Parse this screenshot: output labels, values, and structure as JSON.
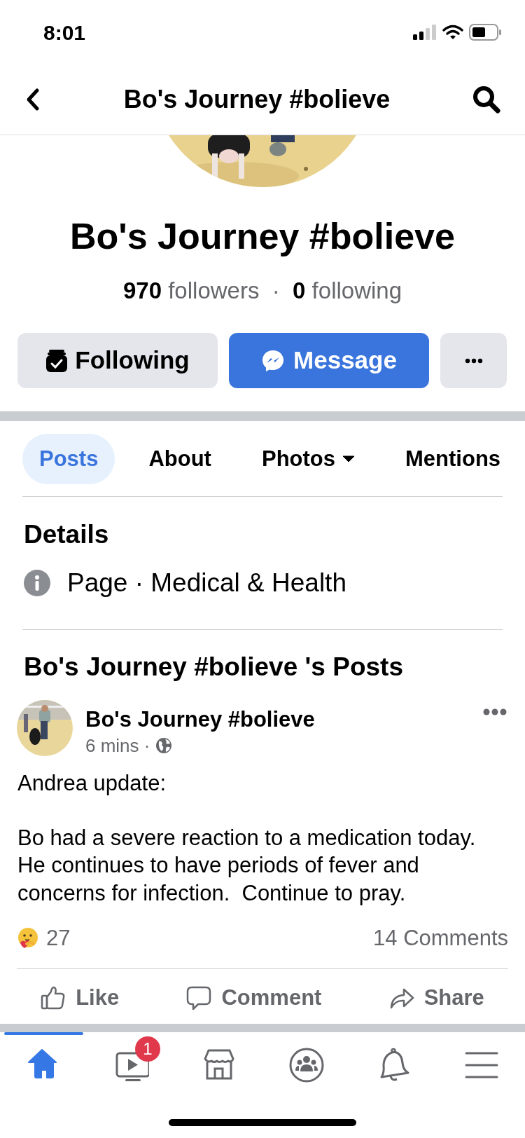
{
  "status_bar": {
    "time": "8:01"
  },
  "nav": {
    "title": "Bo's Journey #bolieve"
  },
  "profile": {
    "name": "Bo's Journey #bolieve",
    "followers_count": "970",
    "followers_label": "followers",
    "separator": "·",
    "following_count": "0",
    "following_label": "following"
  },
  "actions": [
    {
      "kind": "following",
      "label": "Following"
    },
    {
      "kind": "message",
      "label": "Message"
    },
    {
      "kind": "more"
    }
  ],
  "tabs": [
    {
      "label": "Posts",
      "selected": true,
      "has_menu": false
    },
    {
      "label": "About",
      "selected": false,
      "has_menu": false
    },
    {
      "label": "Photos",
      "selected": false,
      "has_menu": true
    },
    {
      "label": "Mentions",
      "selected": false,
      "has_menu": false
    }
  ],
  "details": {
    "title": "Details",
    "category": "Page · Medical & Health"
  },
  "posts_header": "Bo's Journey #bolieve 's Posts",
  "post": {
    "author": "Bo's Journey #bolieve",
    "time": "6 mins ·",
    "paragraphs": [
      "Andrea update:",
      "Bo had a severe reaction to a medication today. He continues to have periods of fever and concerns for infection.  Continue to pray."
    ],
    "reactions": "27",
    "comments": "14 Comments"
  },
  "post_actions": [
    {
      "kind": "like",
      "label": "Like"
    },
    {
      "kind": "comment",
      "label": "Comment"
    },
    {
      "kind": "share",
      "label": "Share"
    }
  ],
  "bottom_tabs": [
    {
      "kind": "home",
      "selected": true
    },
    {
      "kind": "watch",
      "selected": false,
      "badge": "1"
    },
    {
      "kind": "marketplace",
      "selected": false
    },
    {
      "kind": "groups",
      "selected": false
    },
    {
      "kind": "notifications",
      "selected": false
    },
    {
      "kind": "menu",
      "selected": false
    }
  ]
}
